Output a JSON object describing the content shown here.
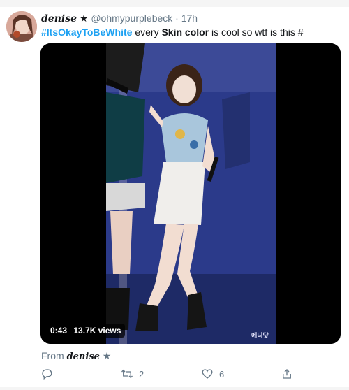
{
  "tweet": {
    "display_name": "denise",
    "star": "★",
    "handle": "@ohmypurplebeck",
    "dot": "·",
    "time": "17h",
    "text": {
      "hashtag": "#ItsOkayToBeWhite",
      "part1": "every",
      "bold": "Skin color",
      "part2": "is cool so wtf is this #"
    }
  },
  "media": {
    "time": "0:43",
    "views": "13.7K views",
    "watermark": "에니닷"
  },
  "from": {
    "label": "From",
    "name": "denise",
    "star": "★"
  },
  "actions": {
    "reply_icon": "reply-icon",
    "retweet_icon": "retweet-icon",
    "retweet_count": "2",
    "like_icon": "heart-icon",
    "like_count": "6",
    "share_icon": "share-icon"
  },
  "colors": {
    "hashtag": "#1da1f2",
    "muted": "#657786",
    "stage": "#2b3a8a"
  }
}
